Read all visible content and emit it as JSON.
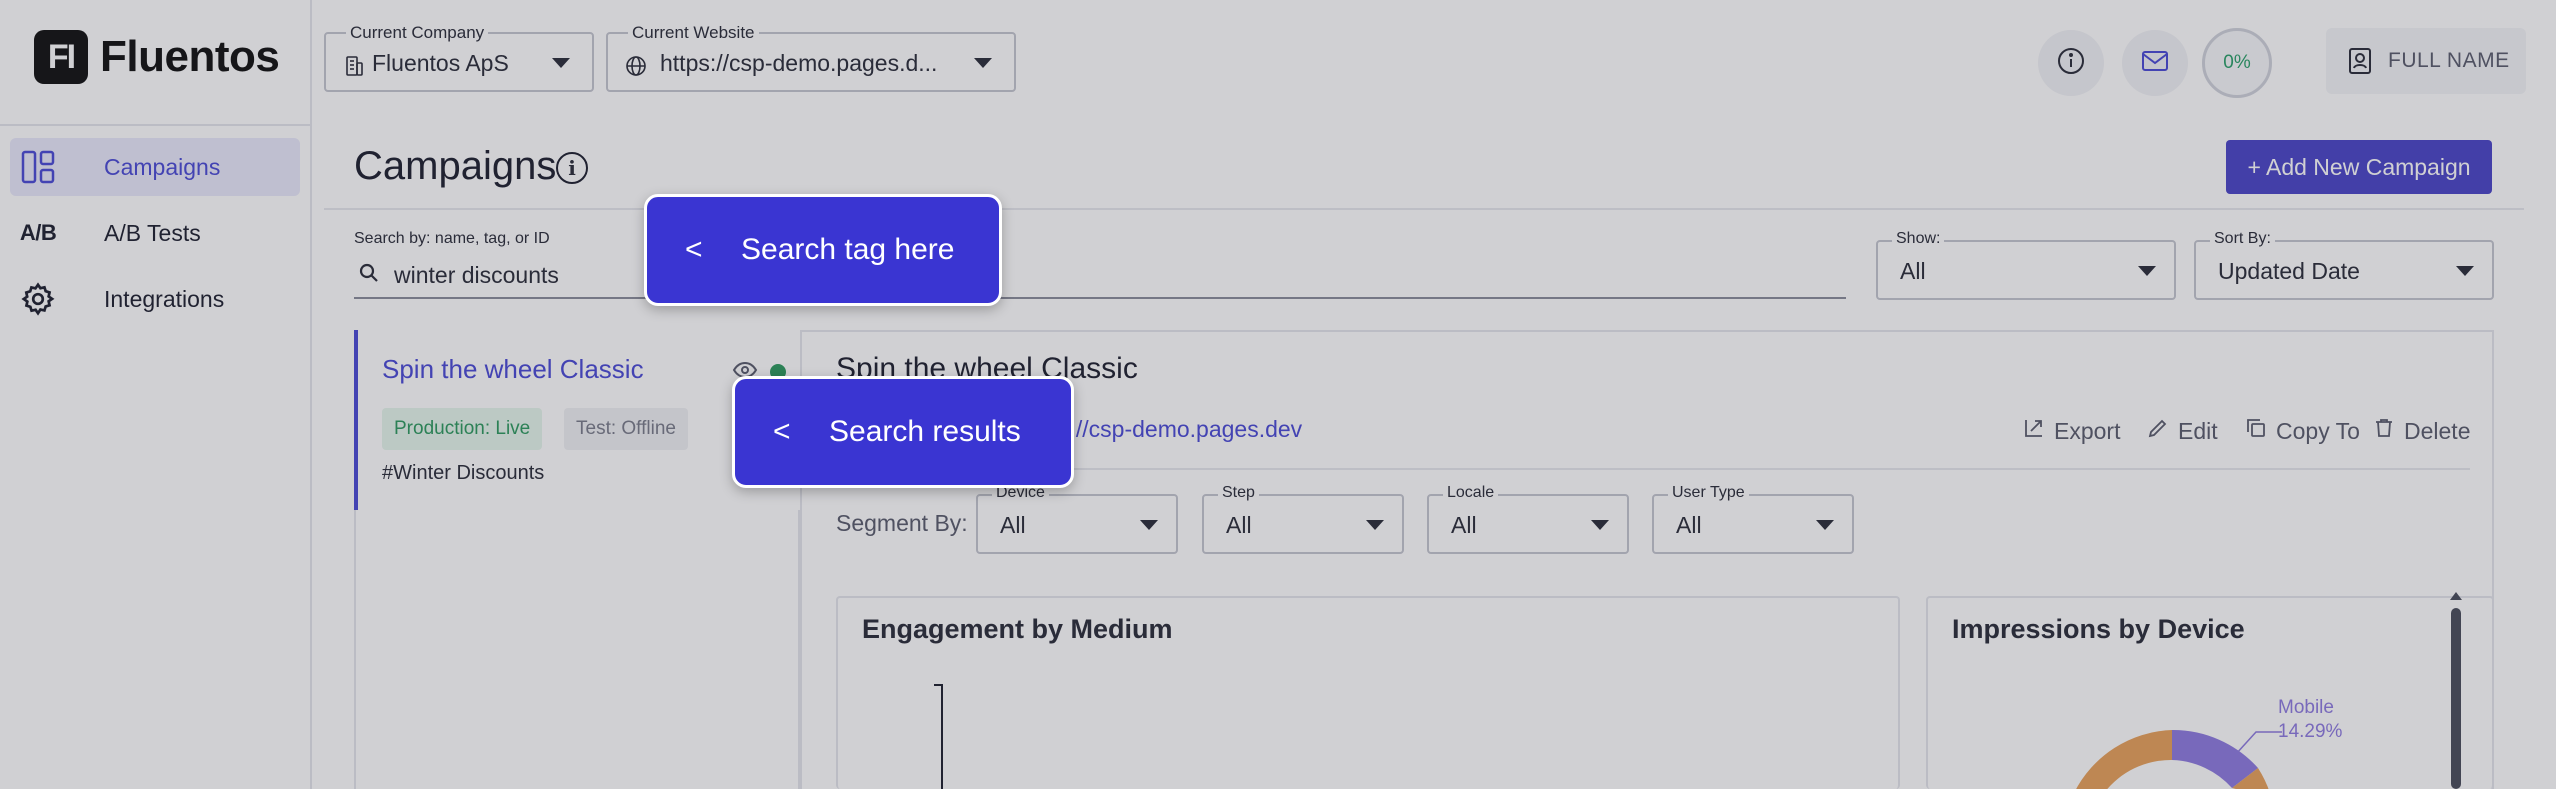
{
  "brand": {
    "logo_mark": "FI",
    "name": "Fluentos"
  },
  "sidebar": {
    "items": [
      {
        "label": "Campaigns",
        "icon": "campaigns-icon",
        "active": true
      },
      {
        "label": "A/B Tests",
        "icon": "ab-tests-icon",
        "icon_text": "A/B",
        "active": false
      },
      {
        "label": "Integrations",
        "icon": "gear-icon",
        "active": false
      }
    ]
  },
  "topbar": {
    "company": {
      "legend": "Current Company",
      "value": "Fluentos ApS"
    },
    "website": {
      "legend": "Current Website",
      "value": "https://csp-demo.pages.d..."
    },
    "progress": "0%",
    "user_label": "FULL NAME"
  },
  "page": {
    "title": "Campaigns",
    "add_button": "+ Add New Campaign"
  },
  "search": {
    "label": "Search by: name, tag, or ID",
    "value": "winter discounts"
  },
  "filters": {
    "show": {
      "legend": "Show:",
      "value": "All"
    },
    "sort": {
      "legend": "Sort By:",
      "value": "Updated Date"
    }
  },
  "campaign": {
    "title": "Spin the wheel Classic",
    "production_badge": "Production: Live",
    "test_badge": "Test: Offline",
    "tag": "#Winter Discounts"
  },
  "detail": {
    "title": "Spin the wheel Classic",
    "url": "s://csp-demo.pages.dev",
    "actions": {
      "export": "Export",
      "edit": "Edit",
      "copy": "Copy To",
      "delete": "Delete"
    },
    "segment_label": "Segment By:",
    "segments": [
      {
        "legend": "Device",
        "value": "All"
      },
      {
        "legend": "Step",
        "value": "All"
      },
      {
        "legend": "Locale",
        "value": "All"
      },
      {
        "legend": "User Type",
        "value": "All"
      }
    ]
  },
  "charts": {
    "engagement_title": "Engagement by Medium",
    "impressions_title": "Impressions by Device",
    "mobile_label": "Mobile",
    "mobile_value": "14.29%"
  },
  "tour": {
    "search_tip": "Search tag here",
    "results_tip": "Search results",
    "arrow": "<"
  },
  "colors": {
    "accent": "#4b46c8",
    "tour": "#3a35d2",
    "live": "#2d9a5f",
    "donut_orange": "#e8a25c",
    "donut_purple": "#8f7be0"
  }
}
